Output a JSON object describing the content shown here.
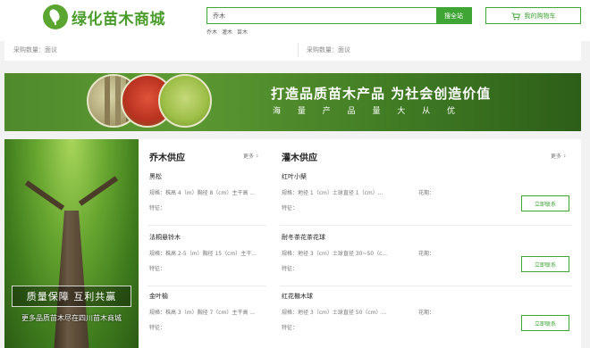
{
  "header": {
    "logo_text": "绿化苗木商城",
    "search": {
      "value": "乔木",
      "button_label": "搜全站"
    },
    "hot_words": [
      "乔木",
      "灌木",
      "苗木"
    ],
    "cart_label": "我的购物车"
  },
  "strip": {
    "left_text": "采购数量：面议",
    "right_text": "采购数量：面议"
  },
  "banner": {
    "title": "打造品质苗木产品 为社会创造价值",
    "subtitle": "海 量 产 品 量 大 从 优"
  },
  "promo": {
    "slogan": "质量保障 互利共赢",
    "bottom_text": "更多品质苗木尽在四川苗木商城"
  },
  "columns": {
    "arbor": {
      "title": "乔木供应",
      "more": "更多",
      "items": [
        {
          "name": "黑松",
          "spec": "规格：株高 4（m）胸径 8（cm）主干高 ...",
          "trait": "特征："
        },
        {
          "name": "法桐悬铃木",
          "spec": "规格：株高 2-5（m）胸径 15（cm）主干...",
          "trait": "特征："
        },
        {
          "name": "金叶榆",
          "spec": "规格：株高 3（m）胸径 7（cm）主干高 ...",
          "trait": "特征："
        }
      ]
    },
    "shrub": {
      "title": "灌木供应",
      "more": "更多",
      "items": [
        {
          "name": "红叶小檗",
          "spec": "规格：地径 1（cm）土球直径 1（cm）...",
          "flower": "花期：",
          "trait": "特征：",
          "button": "立即联系"
        },
        {
          "name": "耐冬茶花茶花球",
          "spec": "规格：地径 3（cm）土球直径 30~50（c...",
          "flower": "花期：",
          "trait": "特征：",
          "button": "立即联系"
        },
        {
          "name": "红花檵木球",
          "spec": "规格：地径 3（cm）土球直径 50（cm）...",
          "flower": "花期：",
          "trait": "特征：",
          "button": "立即联系"
        }
      ]
    }
  },
  "colors": {
    "brand_green": "#3fa535",
    "logo_green": "#4a9d2a"
  },
  "icons": [
    "leaf-logo-icon",
    "cart-icon",
    "chevron-right-icon"
  ]
}
